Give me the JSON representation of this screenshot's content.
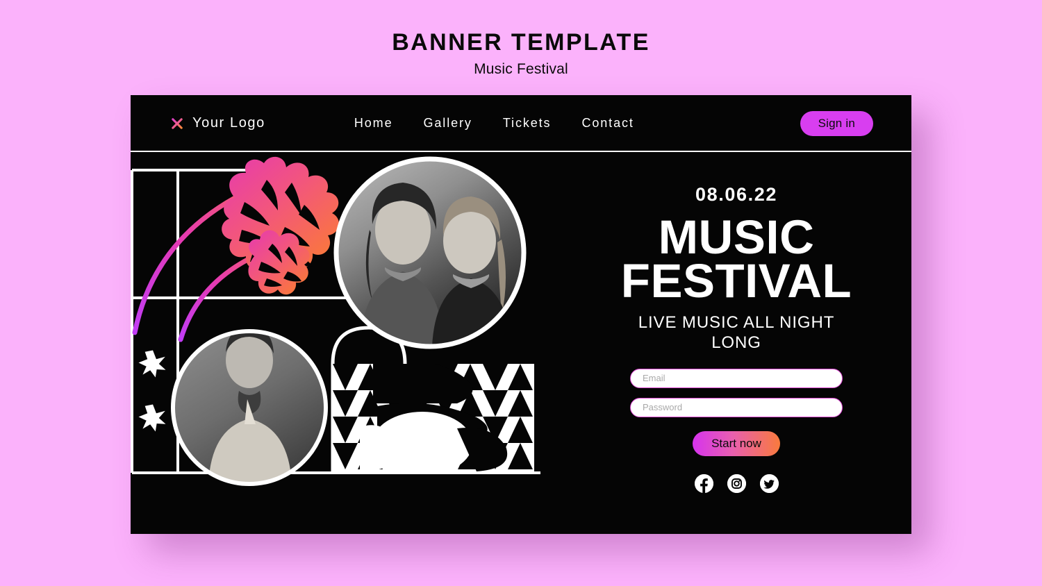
{
  "header": {
    "title": "BANNER TEMPLATE",
    "subtitle": "Music Festival"
  },
  "nav": {
    "logo_text": "Your Logo",
    "logo_icon": "asterisk-flower-icon",
    "links": [
      {
        "label": "Home"
      },
      {
        "label": "Gallery"
      },
      {
        "label": "Tickets"
      },
      {
        "label": "Contact"
      }
    ],
    "signin_label": "Sign in"
  },
  "hero": {
    "date": "08.06.22",
    "title_line1": "MUSIC",
    "title_line2": "FESTIVAL",
    "tagline": "LIVE MUSIC ALL NIGHT LONG",
    "form": {
      "email_placeholder": "Email",
      "email_value": "",
      "password_placeholder": "Password",
      "password_value": "",
      "submit_label": "Start now"
    },
    "socials": [
      {
        "name": "facebook-icon"
      },
      {
        "name": "instagram-icon"
      },
      {
        "name": "twitter-icon"
      }
    ]
  },
  "collage": {
    "photo_top_right": "two-women-portrait-photo",
    "photo_bottom_left": "man-with-scarf-portrait-photo",
    "decor": [
      "monstera-leaf-large",
      "monstera-leaf-small",
      "star-upper",
      "star-lower",
      "triangle-pattern-block",
      "arch-outline",
      "frame-grid-lines"
    ]
  },
  "colors": {
    "page_background": "#fbb2fb",
    "banner_background": "#050505",
    "accent_magenta": "#d83ef0",
    "accent_orange": "#f97a3d",
    "text_light": "#ffffff",
    "text_dark": "#0a0a0a"
  }
}
